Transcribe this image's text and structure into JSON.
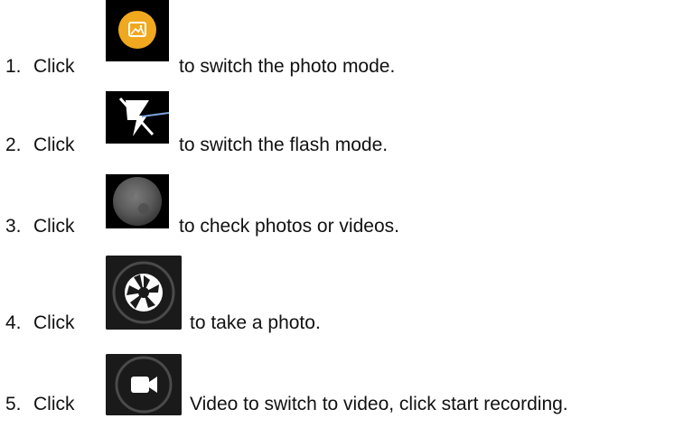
{
  "steps": [
    {
      "number": "1.",
      "click_label": "Click",
      "icon": "photo-mode-icon",
      "text": "to switch the photo mode."
    },
    {
      "number": "2.",
      "click_label": "Click",
      "icon": "flash-off-icon",
      "text": "to switch the flash mode."
    },
    {
      "number": "3.",
      "click_label": "Click",
      "icon": "gallery-thumbnail-icon",
      "text": "to check photos or videos."
    },
    {
      "number": "4.",
      "click_label": "Click",
      "icon": "shutter-icon",
      "text": "to take a photo."
    },
    {
      "number": "5.",
      "click_label": "Click",
      "icon": "video-camera-icon",
      "text": "Video to switch to video, click start recording."
    }
  ],
  "colors": {
    "photo_icon_accent": "#f0a81e",
    "flash_line_accent": "#7da3e0",
    "icon_background": "#000000"
  }
}
